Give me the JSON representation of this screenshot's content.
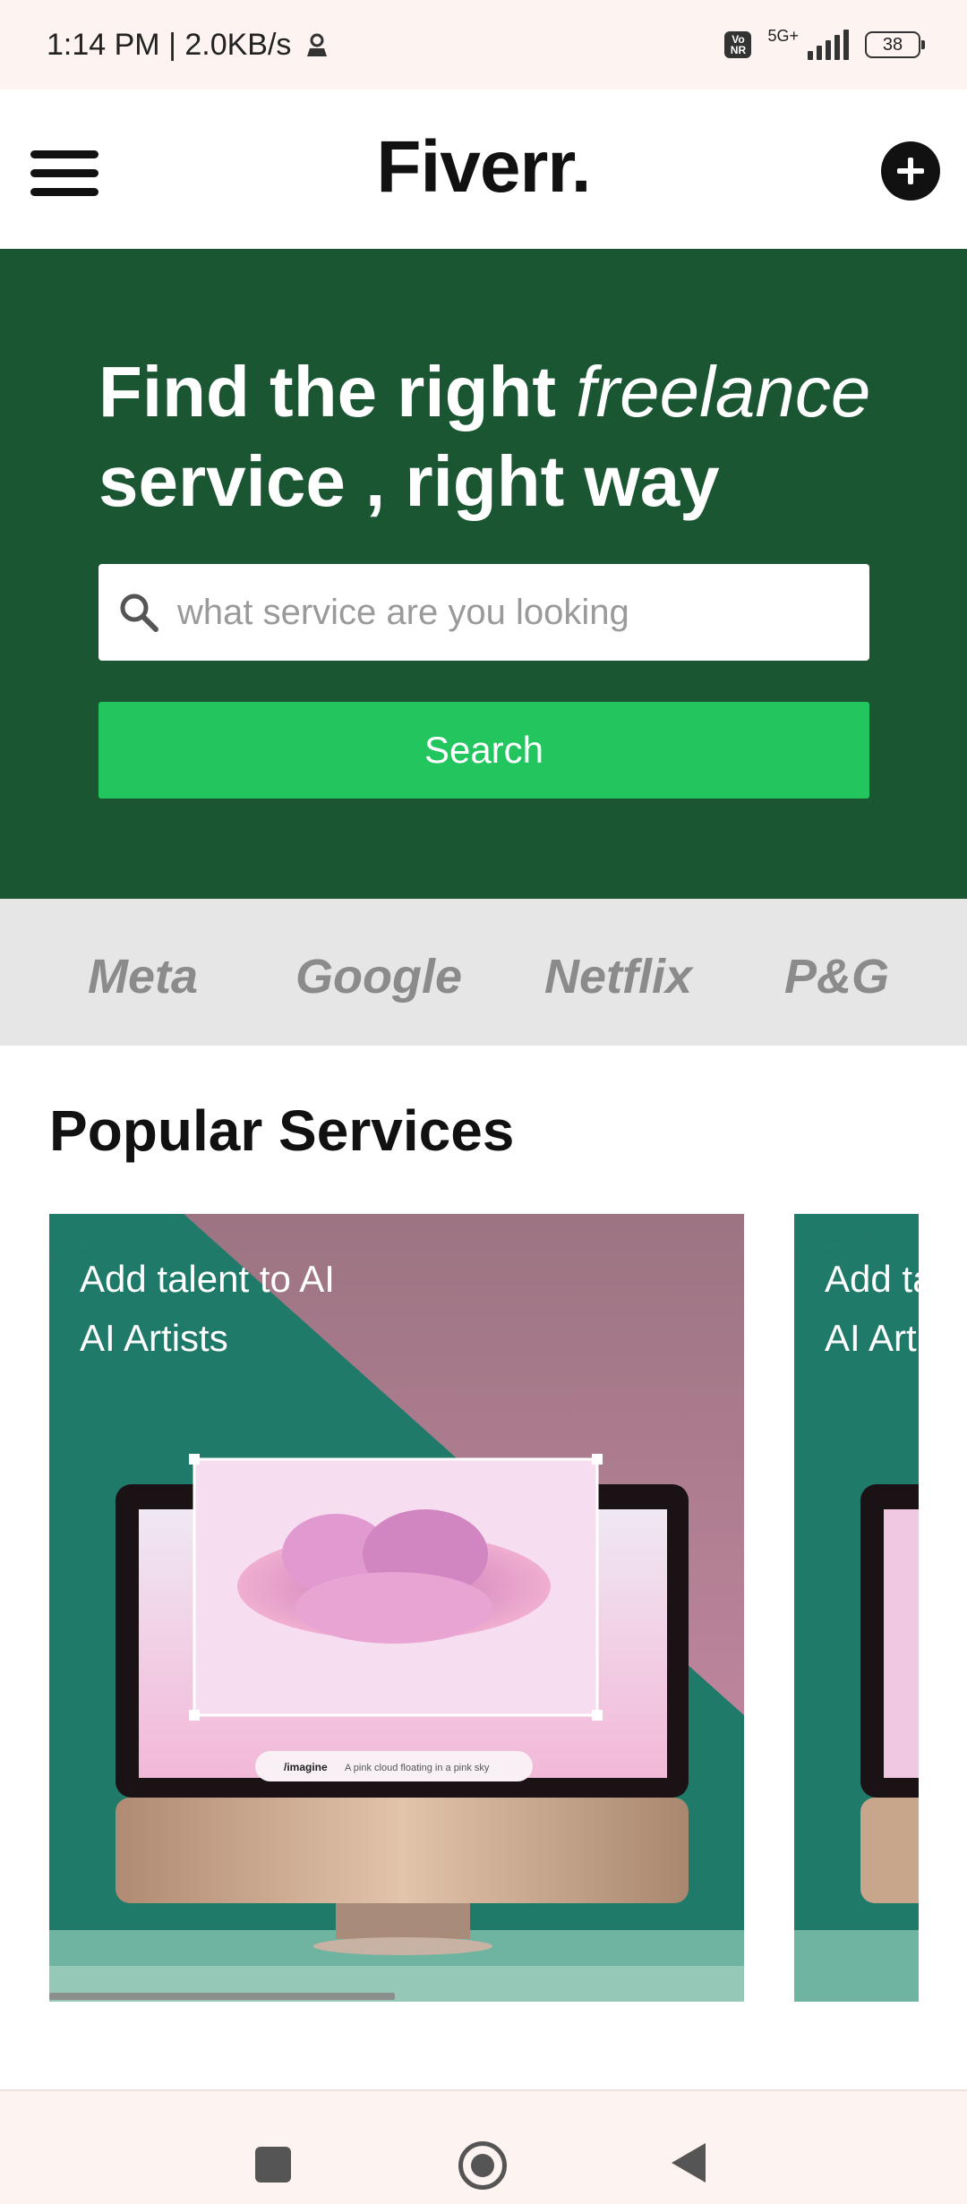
{
  "status_bar": {
    "time_speed": "1:14 PM | 2.0KB/s",
    "network": "5G+",
    "volte": "Vo NR",
    "battery": "38"
  },
  "header": {
    "logo": "Fiverr."
  },
  "hero": {
    "title_part1": "Find the right ",
    "title_italic": "freelance",
    "title_part2": "service , right way",
    "search_placeholder": "what service are you looking",
    "search_button": "Search",
    "color": "#1a5632",
    "button_color": "#22c55e"
  },
  "trusted_by": [
    "Meta",
    "Google",
    "Netflix",
    "P&G"
  ],
  "popular_services": {
    "title": "Popular Services",
    "cards": [
      {
        "subtitle": "Add talent to AI",
        "title": "AI Artists",
        "prompt_tag": "/imagine",
        "prompt_text": "A pink cloud floating in a pink sky"
      },
      {
        "subtitle": "Add talent to AI",
        "title": "AI Artists"
      }
    ]
  }
}
